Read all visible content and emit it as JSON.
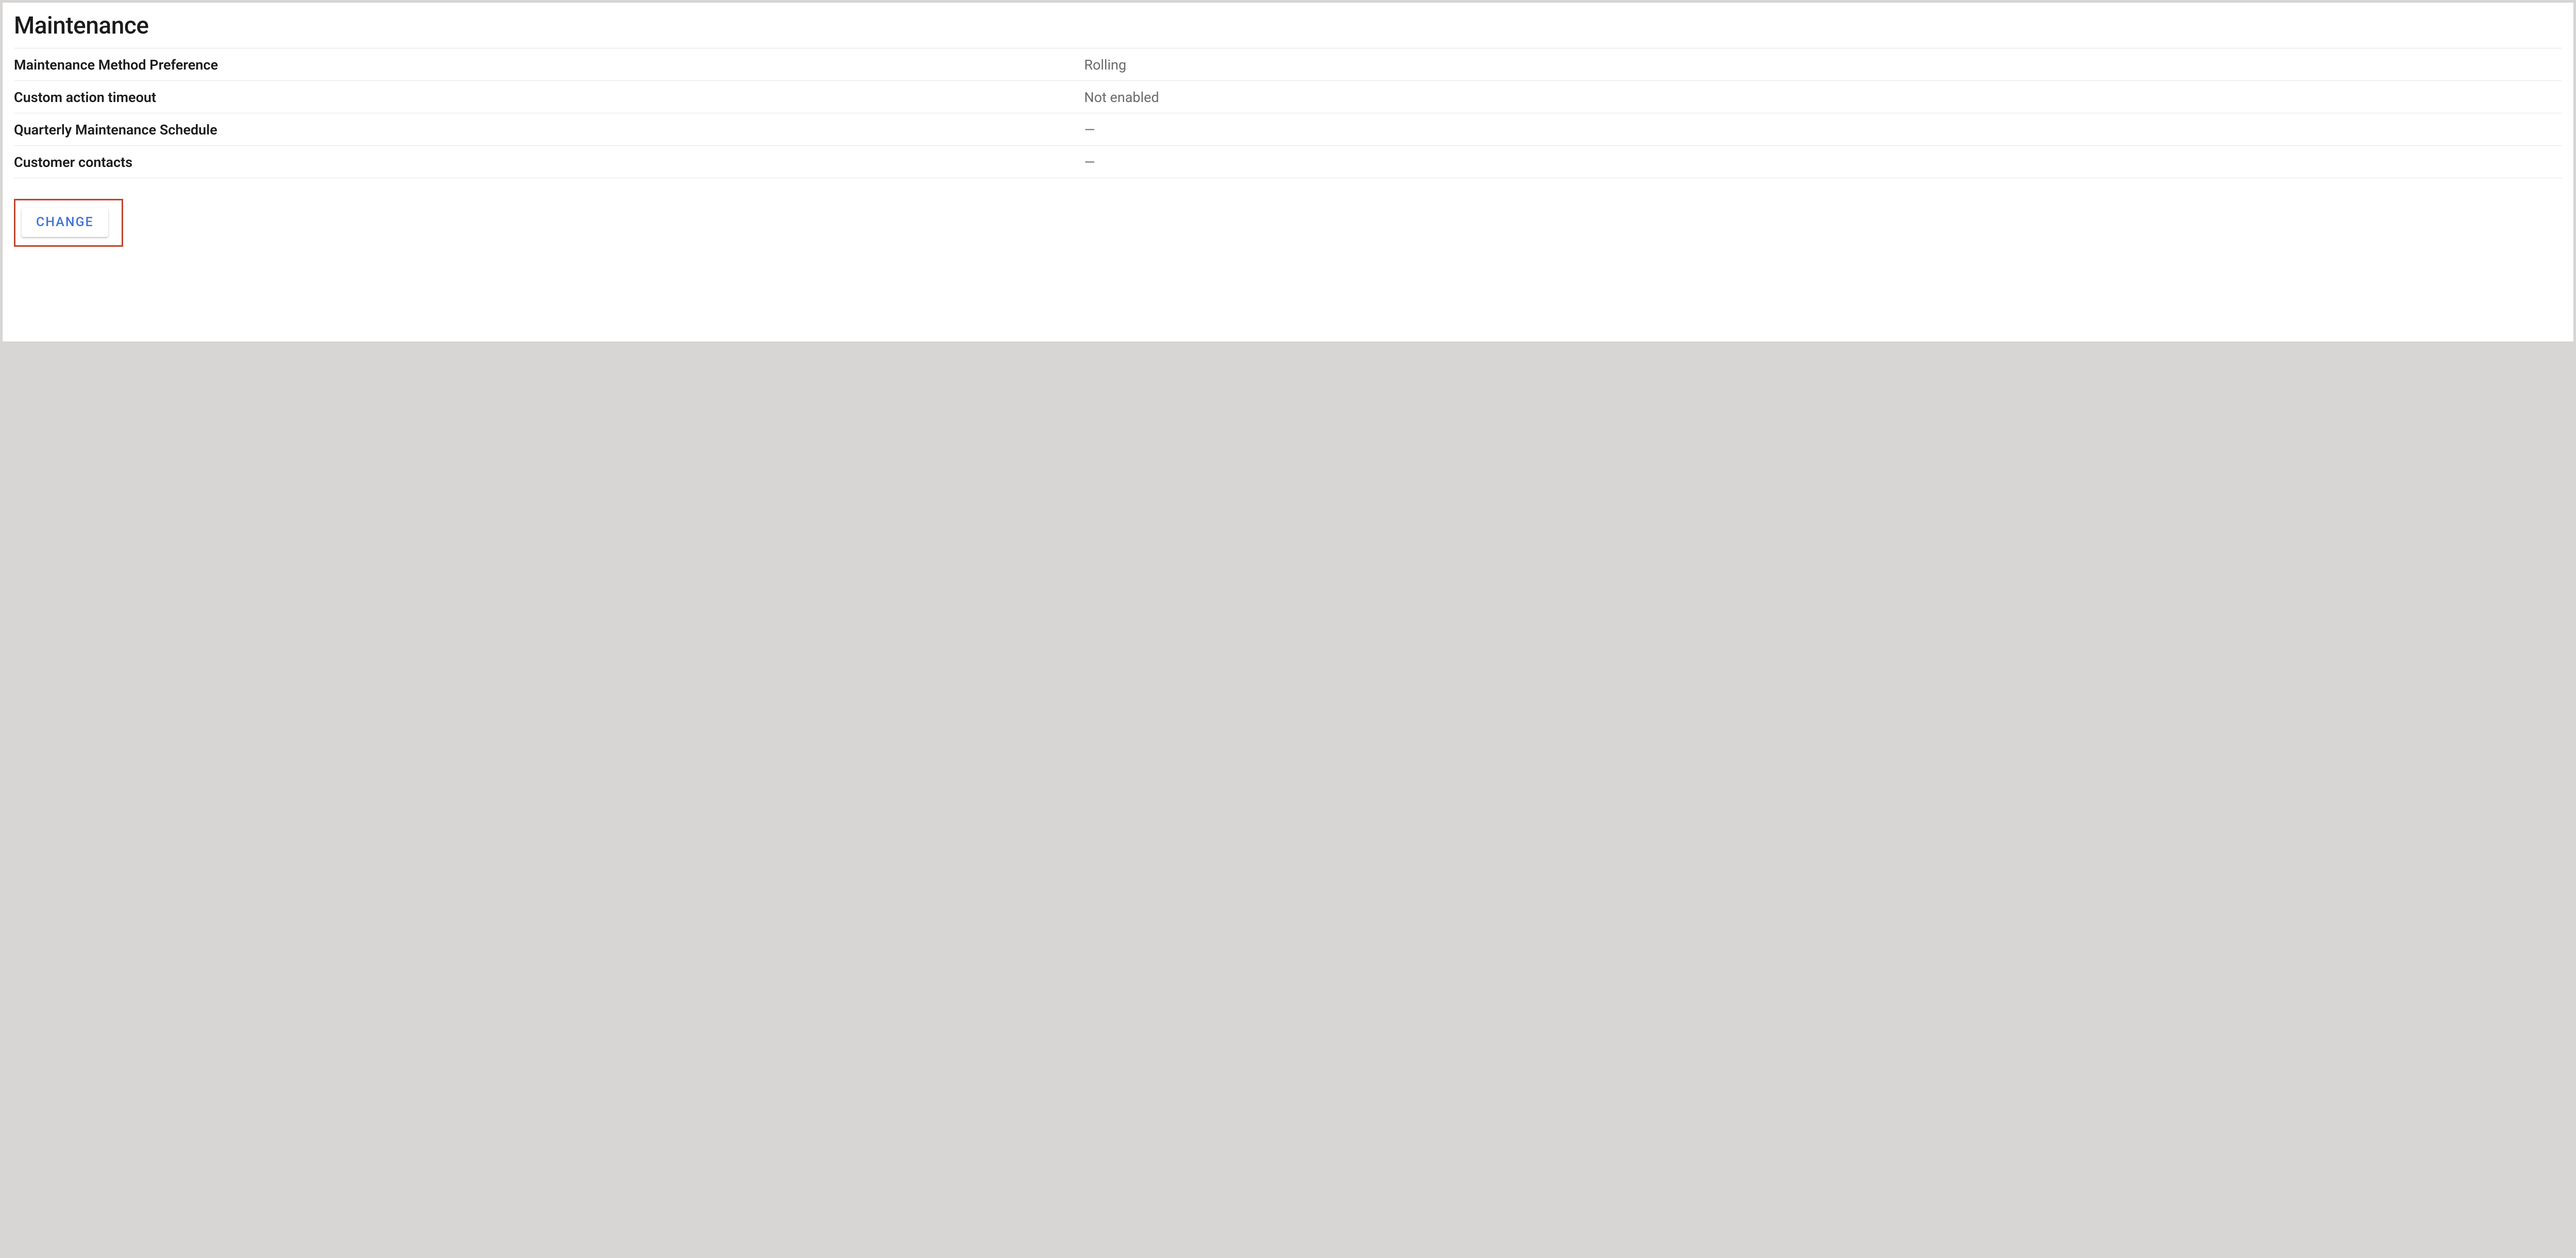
{
  "section": {
    "title": "Maintenance",
    "rows": [
      {
        "label": "Maintenance Method Preference",
        "value": "Rolling"
      },
      {
        "label": "Custom action timeout",
        "value": "Not enabled"
      },
      {
        "label": "Quarterly Maintenance Schedule",
        "value": "—"
      },
      {
        "label": "Customer contacts",
        "value": "—"
      }
    ],
    "change_button_label": "CHANGE"
  }
}
